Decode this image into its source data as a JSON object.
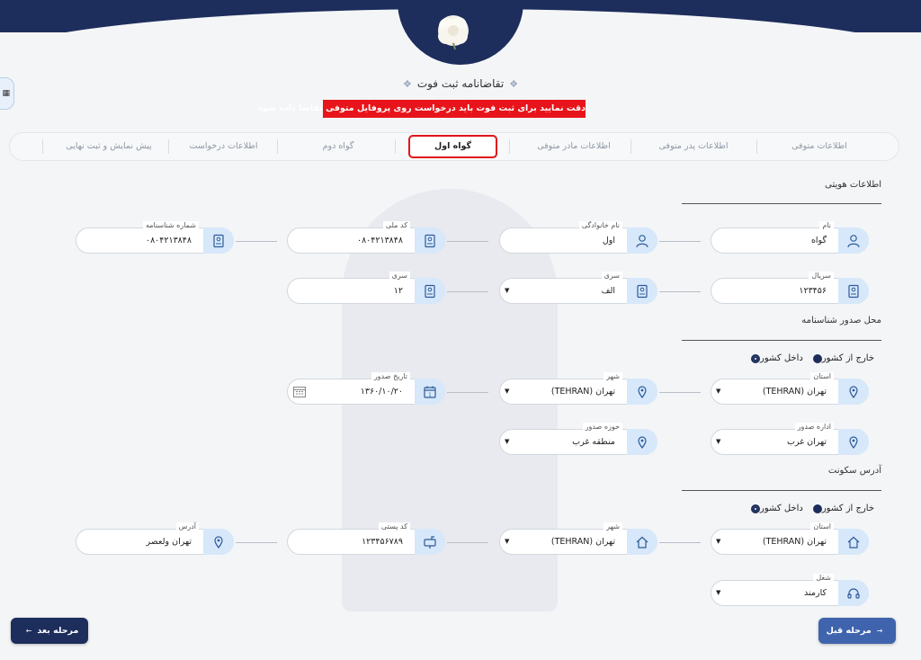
{
  "header": {
    "page_title": "تقاضانامه ثبت فوت",
    "warning": "دقت نمایید برای ثبت فوت باید درخواست روی پروفایل متوفی تقاضا داده شود"
  },
  "steps": [
    {
      "label": "اطلاعات متوفی"
    },
    {
      "label": "اطلاعات پدر متوفی"
    },
    {
      "label": "اطلاعات مادر متوفی"
    },
    {
      "label": "گواه اول",
      "active": true
    },
    {
      "label": "گواه دوم"
    },
    {
      "label": "اطلاعات درخواست"
    },
    {
      "label": "پیش نمایش و ثبت نهایی"
    }
  ],
  "sections": {
    "identity": "اطلاعات هویتی",
    "issue_place": "محل صدور شناسنامه",
    "residence": "آدرس سکونت"
  },
  "identity": {
    "first_name": {
      "label": "نام",
      "value": "گواه"
    },
    "last_name": {
      "label": "نام خانوادگی",
      "value": "اول"
    },
    "national_code": {
      "label": "کد ملی",
      "value": "۰۸۰۴۲۱۳۸۴۸"
    },
    "id_number": {
      "label": "شماره شناسنامه",
      "value": "۰۸۰۴۲۱۳۸۴۸"
    },
    "serial": {
      "label": "سریال",
      "value": "۱۲۳۴۵۶"
    },
    "series_letter": {
      "label": "سری",
      "value": "الف"
    },
    "series_number": {
      "label": "سری",
      "value": "۱۲"
    }
  },
  "issue": {
    "radio_inside": "داخل کشور",
    "radio_outside": "خارج از کشور",
    "province": {
      "label": "استان",
      "value": "تهران (TEHRAN)"
    },
    "city": {
      "label": "شهر",
      "value": "تهران (TEHRAN)"
    },
    "issue_date": {
      "label": "تاریخ صدور",
      "value": "۱۳۶۰/۱۰/۲۰"
    },
    "issue_office": {
      "label": "اداره صدور",
      "value": "تهران غرب"
    },
    "issue_zone": {
      "label": "حوزه صدور",
      "value": "منطقه غرب"
    }
  },
  "residence": {
    "radio_inside": "داخل کشور",
    "radio_outside": "خارج از کشور",
    "province": {
      "label": "استان",
      "value": "تهران (TEHRAN)"
    },
    "city": {
      "label": "شهر",
      "value": "تهران (TEHRAN)"
    },
    "postal_code": {
      "label": "کد پستی",
      "value": "۱۲۳۴۵۶۷۸۹"
    },
    "address": {
      "label": "آدرس",
      "value": "تهران ولعصر"
    },
    "job": {
      "label": "شغل",
      "value": "کارمند"
    }
  },
  "buttons": {
    "next": "مرحله بعد",
    "prev": "مرحله قبل"
  },
  "colors": {
    "navy": "#1d2d5c",
    "accent_blue": "#3f64ad",
    "warning_red": "#e8141b",
    "icon_bg": "#d7e8fa"
  }
}
